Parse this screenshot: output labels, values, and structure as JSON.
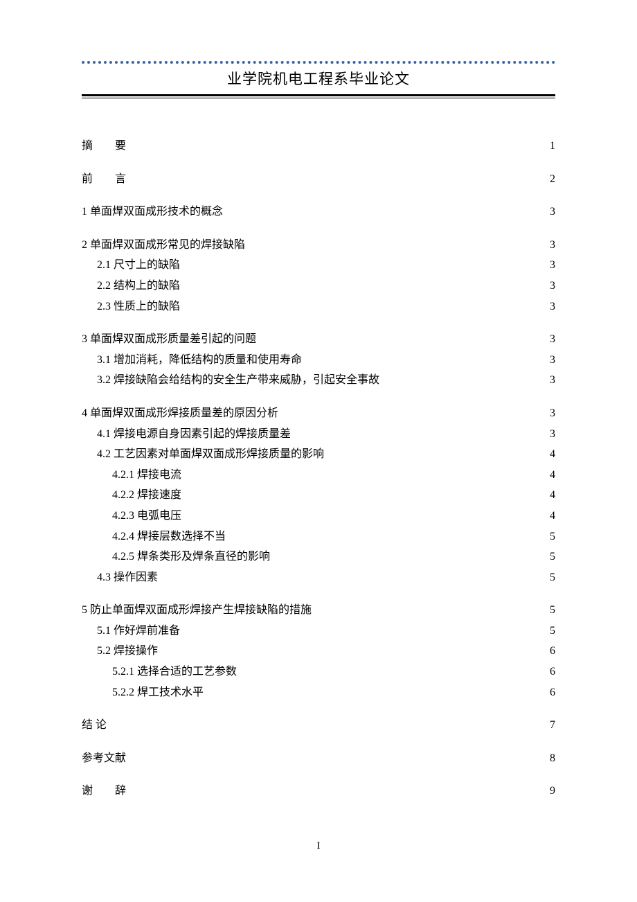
{
  "header": {
    "title": "业学院机电工程系毕业论文"
  },
  "toc": [
    {
      "level": 0,
      "cls": "abstract",
      "label": "摘  要",
      "page": "1"
    },
    {
      "level": 0,
      "cls": "preface",
      "label": "前  言",
      "page": "2"
    },
    {
      "level": 0,
      "label": "1 单面焊双面成形技术的概念",
      "page": "3"
    },
    {
      "level": 0,
      "label": "2 单面焊双面成形常见的焊接缺陷",
      "page": "3"
    },
    {
      "level": 1,
      "label": "2.1 尺寸上的缺陷",
      "page": "3"
    },
    {
      "level": 1,
      "label": "2.2 结构上的缺陷",
      "page": "3"
    },
    {
      "level": 1,
      "label": "2.3 性质上的缺陷",
      "page": "3"
    },
    {
      "level": 0,
      "label": "3 单面焊双面成形质量差引起的问题",
      "page": "3"
    },
    {
      "level": 1,
      "label": "3.1 增加消耗，降低结构的质量和使用寿命",
      "page": "3"
    },
    {
      "level": 1,
      "label": "3.2 焊接缺陷会给结构的安全生产带来威胁，引起安全事故",
      "page": "3"
    },
    {
      "level": 0,
      "label": "4 单面焊双面成形焊接质量差的原因分析",
      "page": "3"
    },
    {
      "level": 1,
      "label": "4.1 焊接电源自身因素引起的焊接质量差",
      "page": "3"
    },
    {
      "level": 1,
      "label": "4.2 工艺因素对单面焊双面成形焊接质量的影响",
      "page": "4"
    },
    {
      "level": 2,
      "label": "4.2.1 焊接电流",
      "page": "4"
    },
    {
      "level": 2,
      "label": "4.2.2 焊接速度",
      "page": "4"
    },
    {
      "level": 2,
      "label": "4.2.3 电弧电压",
      "page": "4"
    },
    {
      "level": 2,
      "label": "4.2.4 焊接层数选择不当",
      "page": "5"
    },
    {
      "level": 2,
      "label": "4.2.5 焊条类形及焊条直径的影响",
      "page": "5"
    },
    {
      "level": 1,
      "label": "4.3 操作因素",
      "page": "5"
    },
    {
      "level": 0,
      "label": "5 防止单面焊双面成形焊接产生焊接缺陷的措施",
      "page": "5"
    },
    {
      "level": 1,
      "label": "5.1 作好焊前准备",
      "page": "5"
    },
    {
      "level": 1,
      "label": "5.2 焊接操作",
      "page": "6"
    },
    {
      "level": 2,
      "label": "5.2.1 选择合适的工艺参数",
      "page": "6"
    },
    {
      "level": 2,
      "label": "5.2.2 焊工技术水平",
      "page": "6"
    },
    {
      "level": 0,
      "label": "结 论",
      "page": "7"
    },
    {
      "level": 0,
      "label": "参考文献",
      "page": "8"
    },
    {
      "level": 0,
      "cls": "ack",
      "label": "谢  辞",
      "page": "9"
    }
  ],
  "footer": {
    "page_number": "I"
  }
}
